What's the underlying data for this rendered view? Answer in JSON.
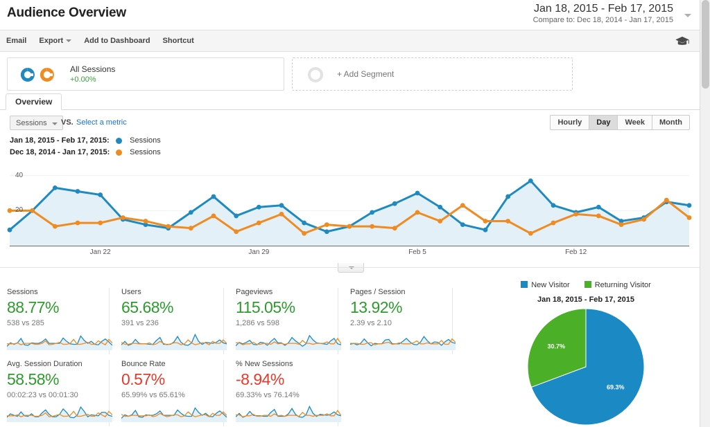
{
  "header": {
    "title": "Audience Overview",
    "date_range": "Jan 18, 2015 - Feb 17, 2015",
    "compare_to": "Compare to: Dec 18, 2014 - Jan 17, 2015"
  },
  "toolbar": {
    "items": [
      {
        "label": "Email",
        "caret": false
      },
      {
        "label": "Export",
        "caret": true
      },
      {
        "label": "Add to Dashboard",
        "caret": false
      },
      {
        "label": "Shortcut",
        "caret": false
      }
    ],
    "help_icon": "graduation-cap-icon"
  },
  "segments": {
    "applied": {
      "name": "All Sessions",
      "percent": "+0.00%"
    },
    "add": {
      "label": "+ Add Segment"
    }
  },
  "tabs": [
    {
      "label": "Overview",
      "active": true
    }
  ],
  "controls": {
    "metric_selected": "Sessions",
    "vs_label": "VS.",
    "select_metric_link": "Select a metric",
    "granularity": [
      {
        "label": "Hourly",
        "active": false
      },
      {
        "label": "Day",
        "active": true
      },
      {
        "label": "Week",
        "active": false
      },
      {
        "label": "Month",
        "active": false
      }
    ]
  },
  "chart_legend": [
    {
      "date": "Jan 18, 2015 - Feb 17, 2015:",
      "metric": "Sessions",
      "color": "#1f8ac0"
    },
    {
      "date": "Dec 18, 2014 - Jan 17, 2015:",
      "metric": "Sessions",
      "color": "#ef8b20"
    }
  ],
  "chart_data": [
    {
      "type": "line",
      "title": "Sessions over time",
      "xlabel": "",
      "ylabel": "Sessions",
      "ylim": [
        0,
        45
      ],
      "yticks": [
        20,
        40
      ],
      "grid": true,
      "legend_position": "above-left",
      "x_tick_labels": [
        "Jan 22",
        "Jan 29",
        "Feb 5",
        "Feb 12"
      ],
      "x_tick_indices": [
        4,
        11,
        18,
        25
      ],
      "series": [
        {
          "name": "Sessions (Jan 18, 2015 - Feb 17, 2015)",
          "color": "#1f8ac0",
          "fill": "#e3f0f7",
          "values": [
            9,
            20,
            33,
            31,
            29,
            15,
            12,
            10,
            19,
            28,
            17,
            22,
            23,
            13,
            8,
            11,
            19,
            24,
            30,
            22,
            12,
            9,
            28,
            37,
            23,
            19,
            22,
            14,
            16,
            25,
            23
          ]
        },
        {
          "name": "Sessions (Dec 18, 2014 - Jan 17, 2015)",
          "color": "#ef8b20",
          "fill": "none",
          "values": [
            20,
            20,
            11,
            13,
            13,
            16,
            14,
            11,
            10,
            17,
            8,
            13,
            18,
            7,
            12,
            11,
            11,
            10,
            19,
            14,
            23,
            14,
            14,
            7,
            13,
            18,
            17,
            12,
            15,
            26,
            16
          ]
        }
      ]
    },
    {
      "type": "pie",
      "title": "Jan 18, 2015 - Feb 17, 2015",
      "legend_position": "top",
      "labels": [
        "New Visitor",
        "Returning Visitor"
      ],
      "values": [
        69.3,
        30.7
      ],
      "value_labels": [
        "69.3%",
        "30.7%"
      ],
      "colors": [
        "#1b8ac4",
        "#4caf28"
      ]
    }
  ],
  "metric_cards": [
    {
      "title": "Sessions",
      "value": "88.77%",
      "direction": "up",
      "sub": "538 vs 285"
    },
    {
      "title": "Users",
      "value": "65.68%",
      "direction": "up",
      "sub": "391 vs 236"
    },
    {
      "title": "Pageviews",
      "value": "115.05%",
      "direction": "up",
      "sub": "1,286 vs 598"
    },
    {
      "title": "Pages / Session",
      "value": "13.92%",
      "direction": "up",
      "sub": "2.39 vs 2.10"
    },
    {
      "title": "Avg. Session Duration",
      "value": "58.58%",
      "direction": "up",
      "sub": "00:02:23 vs 00:01:30"
    },
    {
      "title": "Bounce Rate",
      "value": "0.57%",
      "direction": "down",
      "sub": "65.99% vs 65.61%"
    },
    {
      "title": "% New Sessions",
      "value": "-8.94%",
      "direction": "down",
      "sub": "69.33% vs 76.14%"
    }
  ],
  "colors": {
    "blue": "#1f8ac0",
    "orange": "#ef8b20",
    "green_up": "#2d9b2d",
    "red_down": "#e8392b",
    "pie_blue": "#1b8ac4",
    "pie_green": "#4caf28",
    "area_fill": "#e3f0f7"
  }
}
